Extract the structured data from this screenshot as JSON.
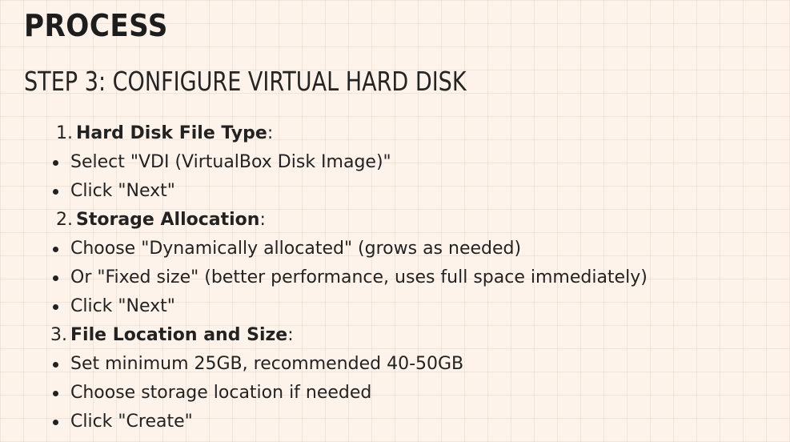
{
  "slide": {
    "title": "PROCESS",
    "subtitle": "STEP 3: CONFIGURE VIRTUAL HARD DISK"
  },
  "sections": [
    {
      "number": "1.",
      "heading": "Hard Disk File Type",
      "suffix": ":",
      "bullets": [
        "Select \"VDI (VirtualBox Disk Image)\"",
        "Click \"Next\""
      ]
    },
    {
      "number": "2.",
      "heading": "Storage Allocation",
      "suffix": ":",
      "bullets": [
        "Choose \"Dynamically allocated\" (grows as needed)",
        "Or \"Fixed size\" (better performance, uses full space immediately)",
        "Click \"Next\""
      ]
    },
    {
      "number": "3.",
      "heading": "File Location and Size",
      "suffix": ":",
      "bullets": [
        "Set minimum 25GB, recommended 40-50GB",
        "Choose storage location if needed",
        "Click \"Create\""
      ]
    }
  ],
  "colors": {
    "background": "#fdf3ea",
    "text": "#222222"
  }
}
